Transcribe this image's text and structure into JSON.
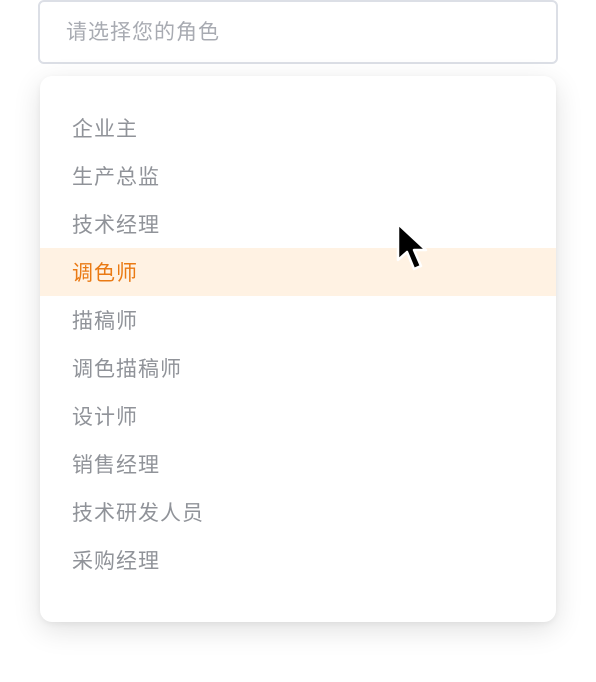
{
  "select": {
    "placeholder": "请选择您的角色"
  },
  "dropdown": {
    "options": [
      {
        "label": "企业主"
      },
      {
        "label": "生产总监"
      },
      {
        "label": "技术经理"
      },
      {
        "label": "调色师"
      },
      {
        "label": "描稿师"
      },
      {
        "label": "调色描稿师"
      },
      {
        "label": "设计师"
      },
      {
        "label": "销售经理"
      },
      {
        "label": "技术研发人员"
      },
      {
        "label": "采购经理"
      }
    ],
    "hovered_label": "调色师"
  },
  "colors": {
    "highlight_bg": "#fff2e3",
    "highlight_text": "#ea7a14",
    "option_text": "#909399",
    "border": "#dcdfe6"
  },
  "icons": {
    "cursor": "mouse-pointer-icon"
  }
}
